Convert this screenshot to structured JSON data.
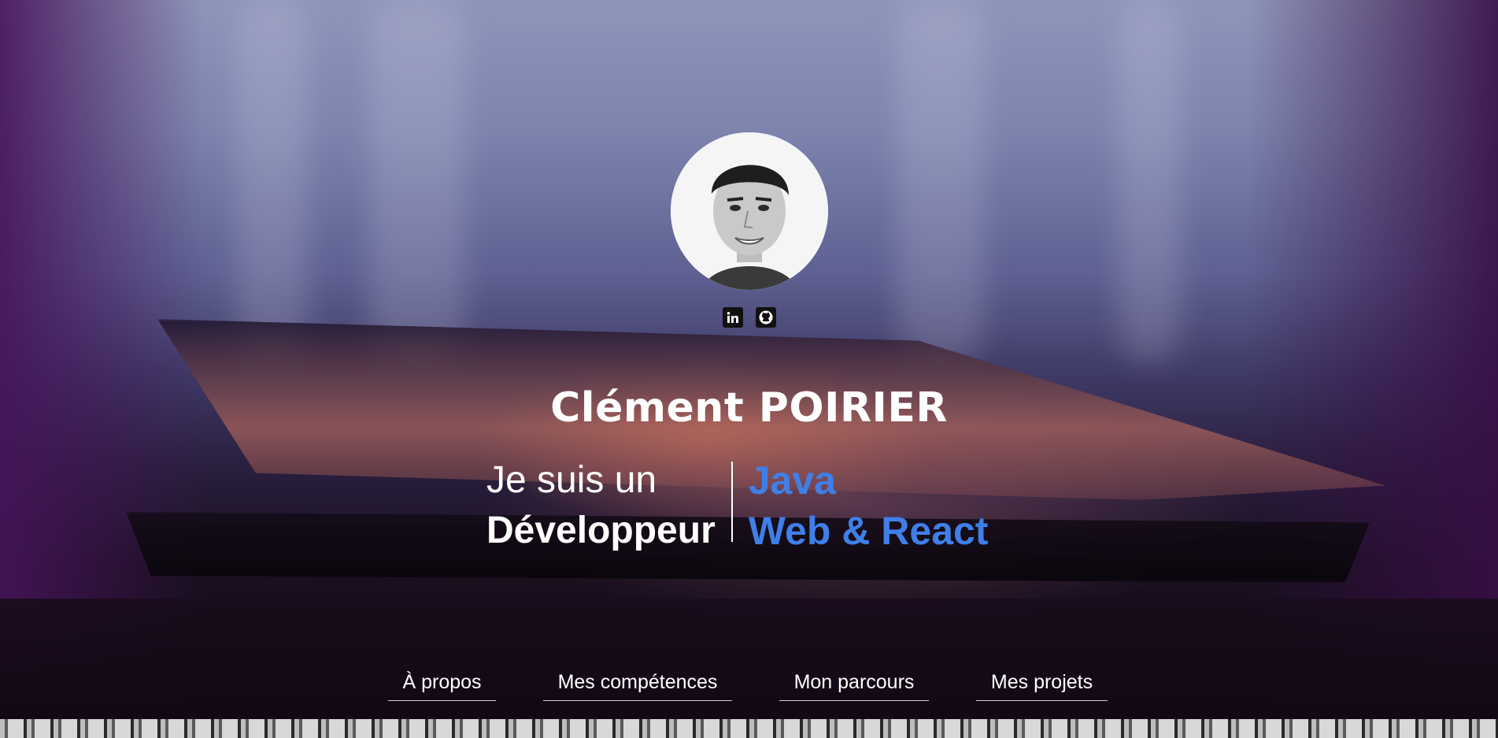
{
  "profile": {
    "name": "Clément POIRIER",
    "avatar_alt": "portrait"
  },
  "socials": [
    {
      "icon": "linkedin-icon",
      "glyph": "in"
    },
    {
      "icon": "github-icon",
      "glyph": "gh"
    }
  ],
  "tagline": {
    "line1": "Je suis un",
    "line2": "Développeur",
    "role1": "Java",
    "role2": "Web & React"
  },
  "nav": {
    "items": [
      {
        "label": "À propos"
      },
      {
        "label": "Mes compétences"
      },
      {
        "label": "Mon parcours"
      },
      {
        "label": "Mes projets"
      }
    ]
  },
  "colors": {
    "accent": "#3f7fe8",
    "text": "#ffffff"
  }
}
